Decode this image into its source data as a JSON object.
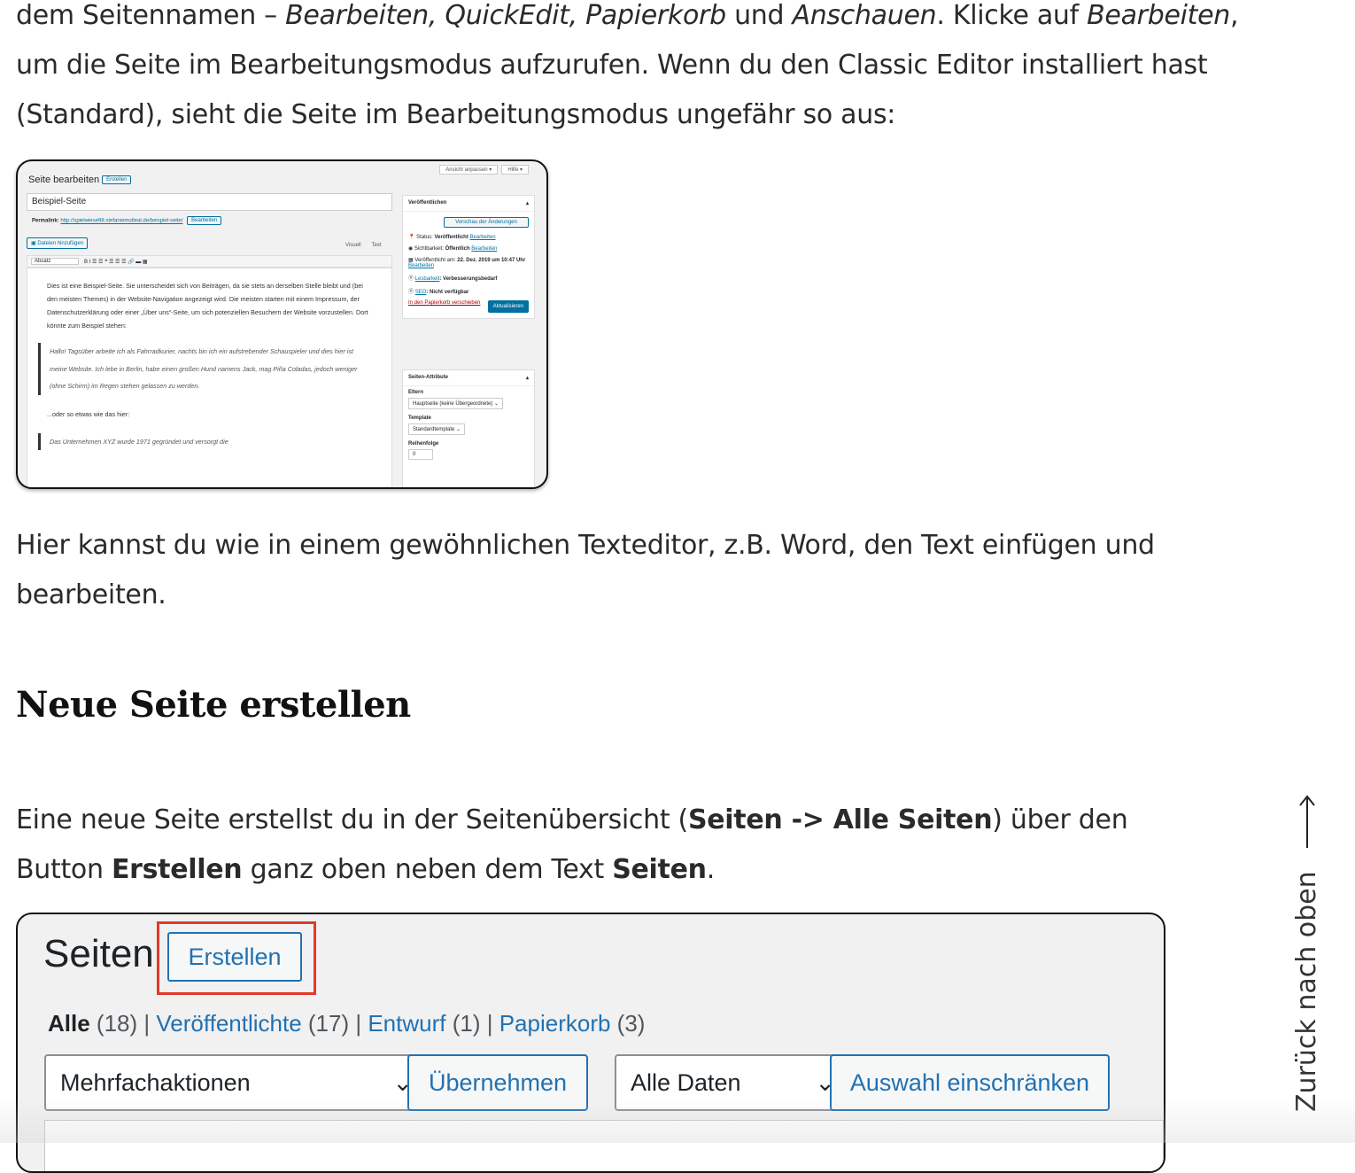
{
  "para1": {
    "t1": "dem Seitennamen – ",
    "i1": "Bearbeiten, QuickEdit, Papierkorb",
    "t2": " und ",
    "i2": "Anschauen",
    "t3": ". Klicke auf ",
    "i3": "Bearbeiten",
    "t4": ", um die Seite im Bearbeitungsmodus aufzurufen. Wenn du den Classic Editor installiert hast (Standard), sieht die Seite im Bearbeitungsmodus ungefähr so aus:"
  },
  "para2": "Hier kannst du wie in einem gewöhnlichen Texteditor, z.B. Word, den Text einfügen und bearbeiten.",
  "section_heading": "Neue Seite erstellen",
  "para3": {
    "t1": "Eine neue Seite erstellst du in der Seitenübersicht (",
    "b1": "Seiten -> Alle Seiten",
    "t2": ") über den Button ",
    "b2": "Erstellen",
    "t3": " ganz oben neben dem Text ",
    "b3": "Seiten",
    "t4": "."
  },
  "shot1": {
    "title": "Seite bearbeiten",
    "create_btn": "Erstellen",
    "screen_options": "Ansicht anpassen ▾",
    "help": "Hilfe ▾",
    "page_title": "Beispiel-Seite",
    "permalink_label": "Permalink:",
    "permalink_url": "http://spielwiese98.stefaniemotleal.de/beispiel-seite/",
    "permalink_edit": "Bearbeiten",
    "add_media": "Dateien hinzufügen",
    "tab_visual": "Visuell",
    "tab_text": "Text",
    "format_select": "Absatz",
    "toolbar_icons": "B  I  ☰  ☰  ❝  ☰  ☰  ☰  🔗  ▬  ▦",
    "body_text": "Dies ist eine Beispiel-Seite. Sie unterscheidet sich von Beiträgen, da sie stets an derselben Stelle bleibt und (bei den meisten Themes) in der Website-Navigation angezeigt wird. Die meisten starten mit einem Impressum, der Datenschutzerklärung oder einer „Über uns“-Seite, um sich potenziellen Besuchern der Website vorzustellen. Dort könnte zum Beispiel stehen:",
    "quote1": "Hallo! Tagsüber arbeite ich als Fahrradkurier, nachts bin ich ein aufstrebender Schauspieler und dies hier ist meine Website. Ich lebe in Berlin, habe einen großen Hund namens Jack, mag Piña Coladas, jedoch weniger (ohne Schirm) im Regen stehen gelassen zu werden.",
    "body_text2": "...oder so etwas wie das hier:",
    "quote2": "Das Unternehmen XYZ wurde 1971 gegründet und versorgt die",
    "publish_heading": "Veröffentlichen",
    "preview_btn": "Vorschau der Änderungen",
    "status_label": "Status: ",
    "status_value": "Veröffentlicht",
    "visibility_label": "Sichtbarkeit: ",
    "visibility_value": "Öffentlich",
    "published_label": "Veröffentlicht am: ",
    "published_value": "22. Dez. 2019 um 10:47 Uhr",
    "edit_link": "Bearbeiten",
    "readability_label": "Lesbarkeit",
    "readability_value": ": Verbesserungsbedarf",
    "seo_label": "SEO",
    "seo_value": ": Nicht verfügbar",
    "trash_link": "In den Papierkorb verschieben",
    "update_btn": "Aktualisieren",
    "attributes_heading": "Seiten-Attribute",
    "parent_label": "Eltern",
    "parent_select": "Hauptseite (keine Übergeordnete) ⌄",
    "template_label": "Template",
    "template_select": "Standardtemplate ⌄",
    "order_label": "Reihenfolge",
    "order_value": "0"
  },
  "shot2": {
    "heading": "Seiten",
    "create_btn": "Erstellen",
    "filter_all": "Alle",
    "filter_all_count": " (18)",
    "filter_published": "Veröffentlichte",
    "filter_published_count": " (17)",
    "filter_draft": "Entwurf",
    "filter_draft_count": " (1)",
    "filter_trash": "Papierkorb",
    "filter_trash_count": " (3)",
    "separator": " | ",
    "bulk_select": "Mehrfachaktionen",
    "apply_btn": "Übernehmen",
    "date_select": "Alle Daten",
    "filter_btn": "Auswahl einschränken"
  },
  "back_to_top": "Zurück nach oben",
  "icons": {
    "arrow": "arrow-up-icon",
    "chevron": "chevron-down-icon"
  },
  "colors": {
    "wp_blue": "#2271b1",
    "highlight_red": "#e4392a"
  }
}
